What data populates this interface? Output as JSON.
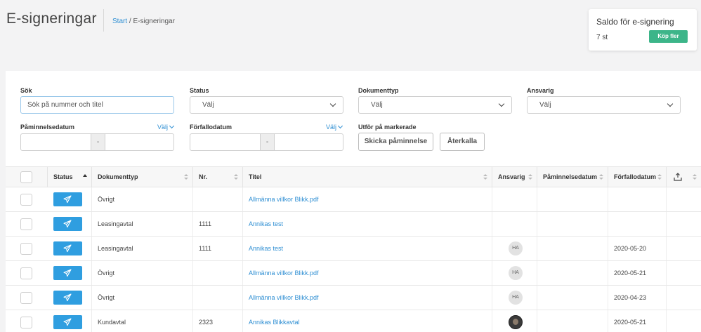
{
  "header": {
    "title": "E-signeringar",
    "breadcrumb": {
      "start": "Start",
      "separator": " / ",
      "current": "E-signeringar"
    }
  },
  "saldo": {
    "title": "Saldo för e-signering",
    "count": "7 st",
    "buy_label": "Köp fler"
  },
  "filters": {
    "search": {
      "label": "Sök",
      "placeholder": "Sök på nummer och titel",
      "value": ""
    },
    "status": {
      "label": "Status",
      "value": "Välj"
    },
    "doctype": {
      "label": "Dokumenttyp",
      "value": "Välj"
    },
    "responsible": {
      "label": "Ansvarig",
      "value": "Välj"
    },
    "reminder_date": {
      "label": "Påminnelsedatum",
      "valj": "Välj",
      "separator": "-"
    },
    "due_date": {
      "label": "Förfallodatum",
      "valj": "Välj",
      "separator": "-"
    },
    "bulk": {
      "label": "Utför på markerade",
      "remind": "Skicka påminnelse",
      "revoke": "Återkalla"
    }
  },
  "table": {
    "columns": [
      "Status",
      "Dokumenttyp",
      "Nr.",
      "Titel",
      "Ansvarig",
      "Påminnelsedatum",
      "Förfallodatum"
    ],
    "rows": [
      {
        "doctype": "Övrigt",
        "nr": "",
        "title": "Allmänna villkor Blikk.pdf",
        "responsible": "",
        "reminder": "",
        "due": ""
      },
      {
        "doctype": "Leasingavtal",
        "nr": "1111",
        "title": "Annikas test",
        "responsible": "",
        "reminder": "",
        "due": ""
      },
      {
        "doctype": "Leasingavtal",
        "nr": "1111",
        "title": "Annikas test",
        "responsible": "HA",
        "reminder": "",
        "due": "2020-05-20"
      },
      {
        "doctype": "Övrigt",
        "nr": "",
        "title": "Allmänna villkor Blikk.pdf",
        "responsible": "HA",
        "reminder": "",
        "due": "2020-05-21"
      },
      {
        "doctype": "Övrigt",
        "nr": "",
        "title": "Allmänna villkor Blikk.pdf",
        "responsible": "HA",
        "reminder": "",
        "due": "2020-04-23"
      },
      {
        "doctype": "Kundavtal",
        "nr": "2323",
        "title": "Annikas Blikkavtal",
        "responsible": "photo",
        "reminder": "",
        "due": "2020-05-21"
      }
    ]
  },
  "colors": {
    "accent": "#2f9ee0",
    "buy": "#3cb589",
    "link": "#2f8fd3"
  },
  "icons": {
    "status_send": "paper-plane-icon",
    "export": "export-icon"
  }
}
